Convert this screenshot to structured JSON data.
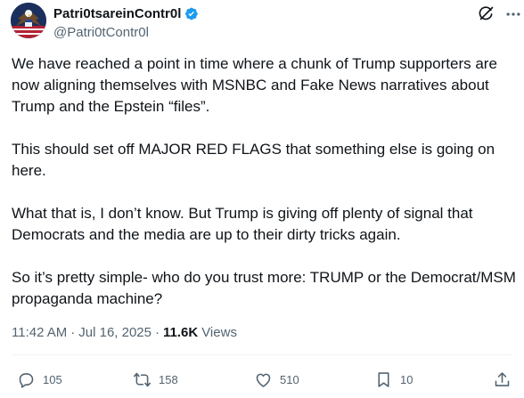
{
  "author": {
    "display_name": "Patri0tsareinContr0l",
    "handle": "@Patri0tContr0l",
    "verified": true
  },
  "tweet": {
    "paragraphs": [
      "We have reached a point in time where a chunk of Trump supporters are now aligning themselves with MSNBC and Fake News narratives about Trump and the Epstein “files”.",
      "This should set off MAJOR RED FLAGS that something else is going on here.",
      "What that is, I don’t know. But Trump is giving off plenty of signal that Democrats and the media are up to their dirty tricks again.",
      "So it’s pretty simple- who do you trust more: TRUMP or the Democrat/MSM propaganda machine?"
    ],
    "time": "11:42 AM",
    "separator": "·",
    "date": "Jul 16, 2025",
    "views_count": "11.6K",
    "views_label": "Views"
  },
  "actions": {
    "replies": "105",
    "reposts": "158",
    "likes": "510",
    "bookmarks": "10"
  },
  "icons": {
    "header_right": [
      "grok-icon",
      "more-options-icon"
    ],
    "action_bar": [
      "reply-icon",
      "repost-icon",
      "like-icon",
      "bookmark-icon",
      "share-icon"
    ]
  },
  "colors": {
    "text_primary": "#0f1419",
    "text_secondary": "#536471",
    "verified_blue": "#1d9bf0",
    "divider": "#eff3f4"
  }
}
